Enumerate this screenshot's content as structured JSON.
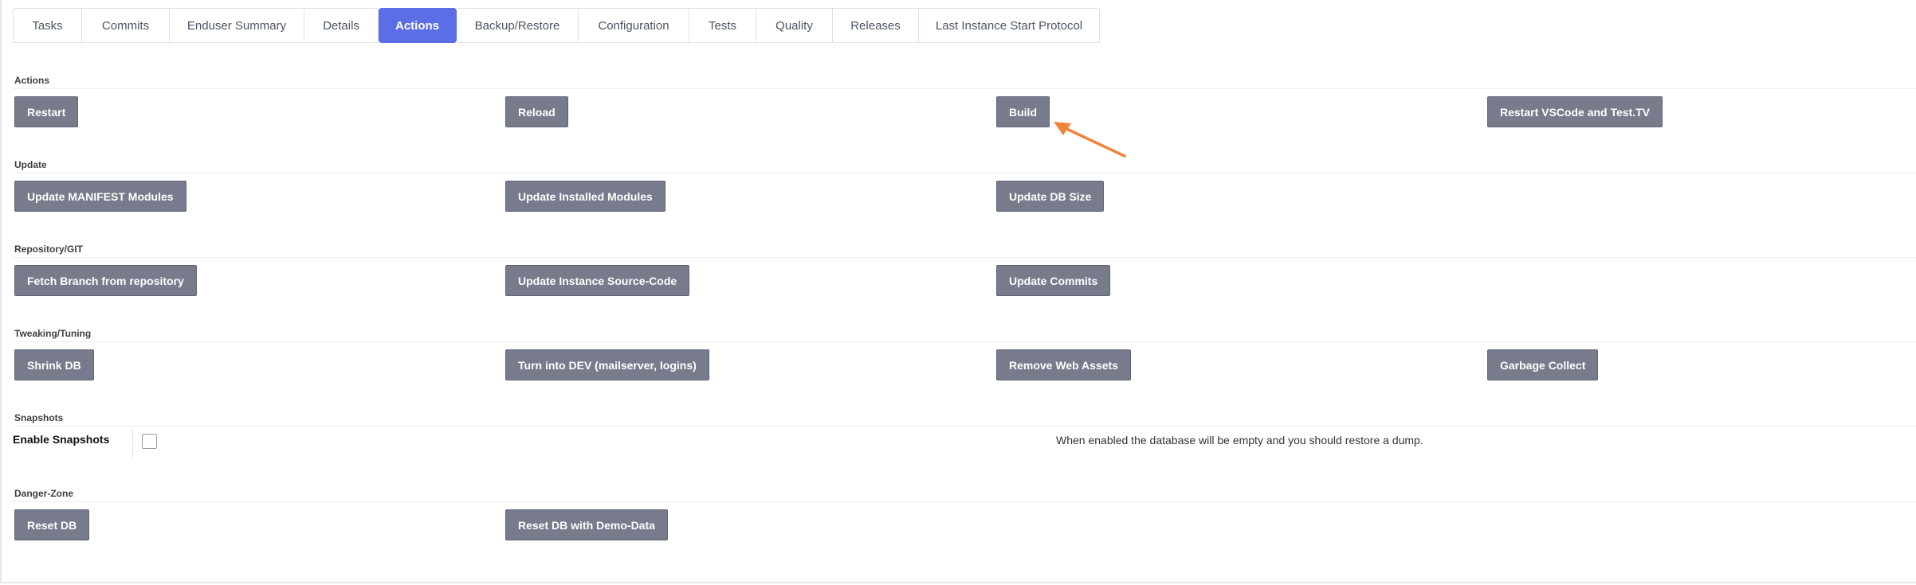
{
  "tabs": [
    {
      "label": "Tasks"
    },
    {
      "label": "Commits"
    },
    {
      "label": "Enduser Summary"
    },
    {
      "label": "Details"
    },
    {
      "label": "Actions",
      "active": true
    },
    {
      "label": "Backup/Restore"
    },
    {
      "label": "Configuration"
    },
    {
      "label": "Tests"
    },
    {
      "label": "Quality"
    },
    {
      "label": "Releases"
    },
    {
      "label": "Last Instance Start Protocol"
    }
  ],
  "sections": {
    "actions": {
      "title": "Actions",
      "buttons": [
        "Restart",
        "Reload",
        "Build",
        "Restart VSCode and Test.TV"
      ]
    },
    "update": {
      "title": "Update",
      "buttons": [
        "Update MANIFEST Modules",
        "Update Installed Modules",
        "Update DB Size"
      ]
    },
    "repository": {
      "title": "Repository/GIT",
      "buttons": [
        "Fetch Branch from repository",
        "Update Instance Source-Code",
        "Update Commits"
      ]
    },
    "tweaking": {
      "title": "Tweaking/Tuning",
      "buttons": [
        "Shrink DB",
        "Turn into DEV (mailserver, logins)",
        "Remove Web Assets",
        "Garbage Collect"
      ]
    },
    "snapshots": {
      "title": "Snapshots",
      "field_label": "Enable Snapshots",
      "checked": false,
      "help_text": "When enabled the database will be empty and you should restore a dump."
    },
    "danger": {
      "title": "Danger-Zone",
      "buttons": [
        "Reset DB",
        "Reset DB with Demo-Data"
      ]
    }
  },
  "colors": {
    "accent": "#5b6ee6",
    "button_bg": "#777b8c",
    "annotation_arrow": "#f0833a"
  }
}
